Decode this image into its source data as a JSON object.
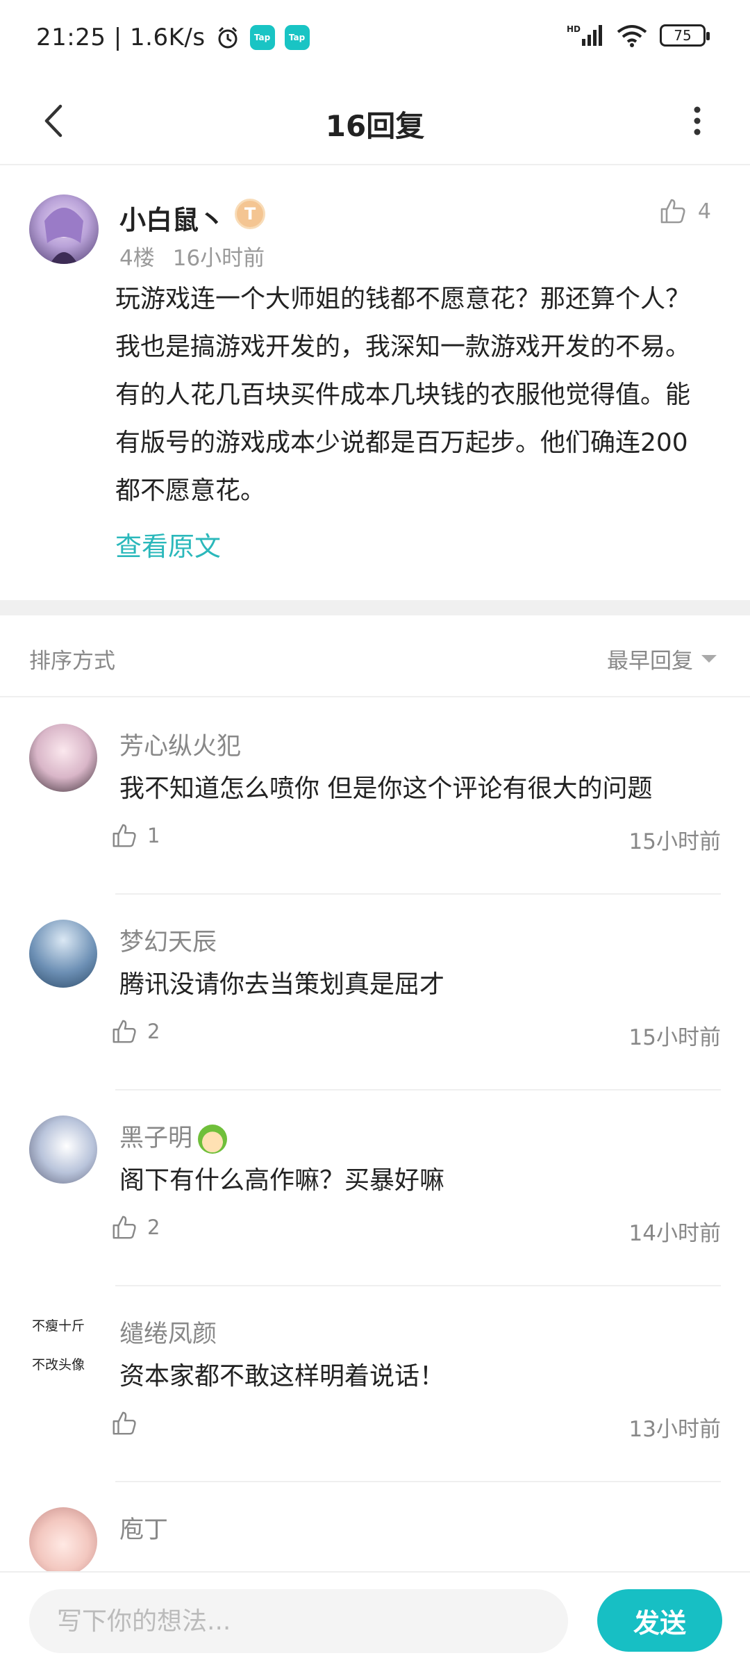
{
  "status_bar": {
    "time": "21:25 | 1.6K/s",
    "app_badge_1": "Tap",
    "app_badge_2": "Tap",
    "network_type": "HD",
    "battery": "75"
  },
  "header": {
    "title": "16回复"
  },
  "main_post": {
    "author": "小白鼠丶",
    "level_badge": "T",
    "floor": "4楼",
    "time": "16小时前",
    "likes": "4",
    "body": "玩游戏连一个大师姐的钱都不愿意花？那还算个人？我也是搞游戏开发的，我深知一款游戏开发的不易。有的人花几百块买件成本几块钱的衣服他觉得值。能有版号的游戏成本少说都是百万起步。他们确连200都不愿意花。",
    "view_original": "查看原文"
  },
  "sort": {
    "label": "排序方式",
    "value": "最早回复"
  },
  "replies": [
    {
      "name": "芳心纵火犯",
      "text": "我不知道怎么喷你  但是你这个评论有很大的问题",
      "likes": "1",
      "time": "15小时前",
      "avatar_color": "#d9b6c8"
    },
    {
      "name": "梦幻天辰",
      "text": "腾讯没请你去当策划真是屈才",
      "likes": "2",
      "time": "15小时前",
      "avatar_color": "#6d90b5"
    },
    {
      "name": "黑子明",
      "text": "阁下有什么高作嘛？买暴好嘛",
      "likes": "2",
      "time": "14小时前",
      "avatar_color": "#b9c4db"
    },
    {
      "name": "缱绻凤颜",
      "text": "资本家都不敢这样明着说话！",
      "likes": "",
      "time": "13小时前",
      "avatar_text_1": "不瘦十斤",
      "avatar_text_2": "不改头像"
    },
    {
      "name": "庖丁",
      "text": "",
      "likes": "",
      "time": "",
      "avatar_color": "#f3c8c0"
    }
  ],
  "composer": {
    "placeholder": "写下你的想法...",
    "send_label": "发送"
  },
  "colors": {
    "accent": "#17bfc4",
    "link": "#2bb8bb"
  }
}
